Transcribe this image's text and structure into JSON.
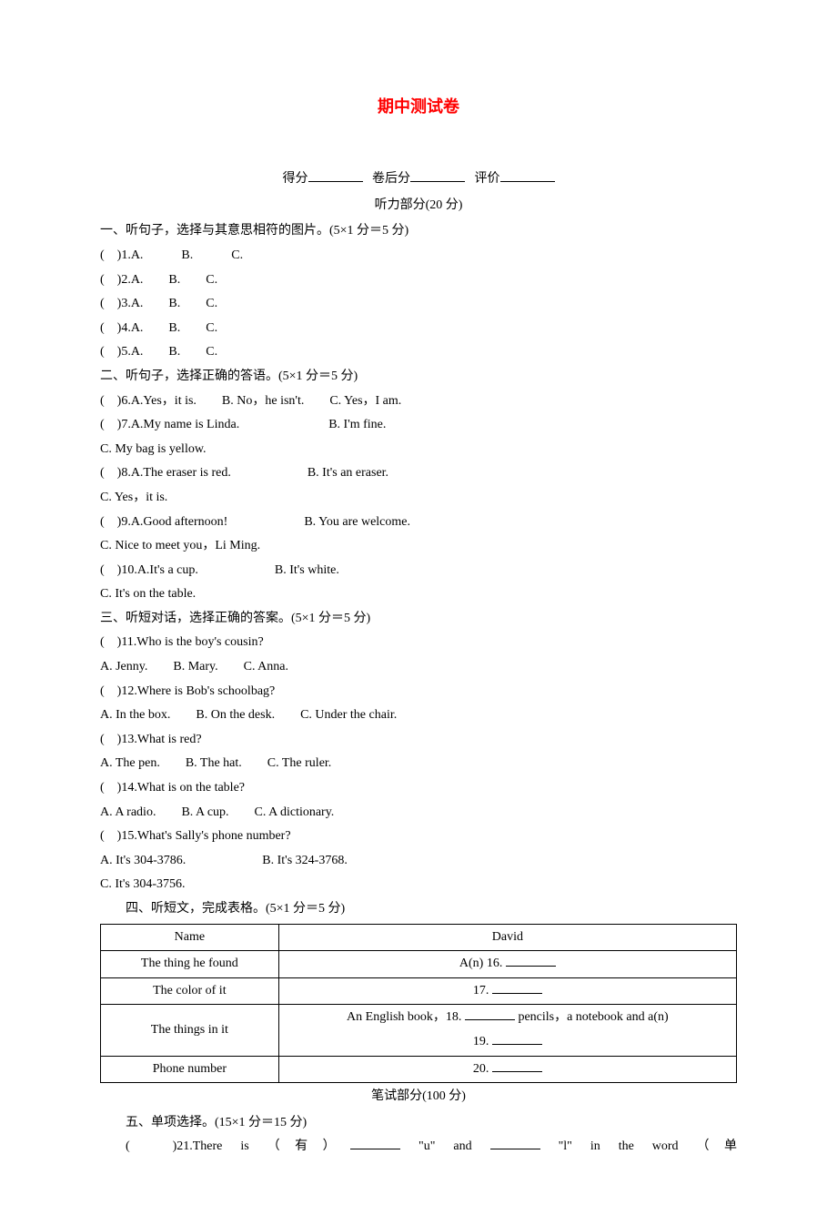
{
  "title": "期中测试卷",
  "score_prefix": "得分",
  "score_mid": "卷后分",
  "score_suffix": "评价",
  "listening_header": "听力部分(20 分)",
  "sec1_title": "一、听句子，选择与其意思相符的图片。(5×1 分＝5 分)",
  "sec1_items": [
    "(　)1.A.　　　B.　　　C.",
    "(　)2.A.　　B.　　C.",
    "(　)3.A.　　B.　　C.",
    "(　)4.A.　　B.　　C.",
    "(　)5.A.　　B.　　C."
  ],
  "sec2_title": "二、听句子，选择正确的答语。(5×1 分＝5 分)",
  "sec2_items": [
    "(　)6.A.Yes，it is.　　B. No，he isn't.　　C. Yes，I am.",
    "(　)7.A.My name is Linda.　　　　　　　B. I'm fine.",
    "C. My bag is yellow.",
    "(　)8.A.The eraser is red.　　　　　　B. It's an eraser.",
    "C. Yes，it is.",
    "(　)9.A.Good afternoon!　　　　　　B. You are welcome.",
    "C. Nice to meet you，Li Ming.",
    "(　)10.A.It's a cup.　　　　　　B. It's white.",
    "C. It's on the table."
  ],
  "sec3_title": "三、听短对话，选择正确的答案。(5×1 分＝5 分)",
  "sec3_items": [
    "(　)11.Who is the boy's cousin?",
    "A. Jenny.　　B. Mary.　　C. Anna.",
    "(　)12.Where is Bob's schoolbag?",
    "A. In the box.　　B. On the desk.　　C. Under the chair.",
    "(　)13.What is red?",
    "A. The pen.　　B. The hat.　　C. The ruler.",
    "(　)14.What is on the table?",
    "A. A radio.　　B. A cup.　　C. A dictionary.",
    "(　)15.What's Sally's phone number?",
    "A. It's 304-3786.　　　　　　B. It's 324-3768.",
    "C. It's 304-3756."
  ],
  "sec4_title": "四、听短文，完成表格。(5×1 分＝5 分)",
  "table": {
    "r1c1": "Name",
    "r1c2": "David",
    "r2c1": "The thing he found",
    "r2c2a": "A(n) 16. ",
    "r3c1": "The color of it",
    "r3c2a": "17. ",
    "r4c1": "The things in it",
    "r4c2a": "An English book，18. ",
    "r4c2b": " pencils，a notebook and a(n)",
    "r4c2c": "19. ",
    "r5c1": "Phone number",
    "r5c2a": "20. "
  },
  "written_header": "笔试部分(100 分)",
  "sec5_title": "五、单项选择。(15×1 分＝15 分)",
  "q21a": "(　)21.There is （有）",
  "q21b": " \"u\"  and  ",
  "q21c": " \"l\"  in the word （单"
}
